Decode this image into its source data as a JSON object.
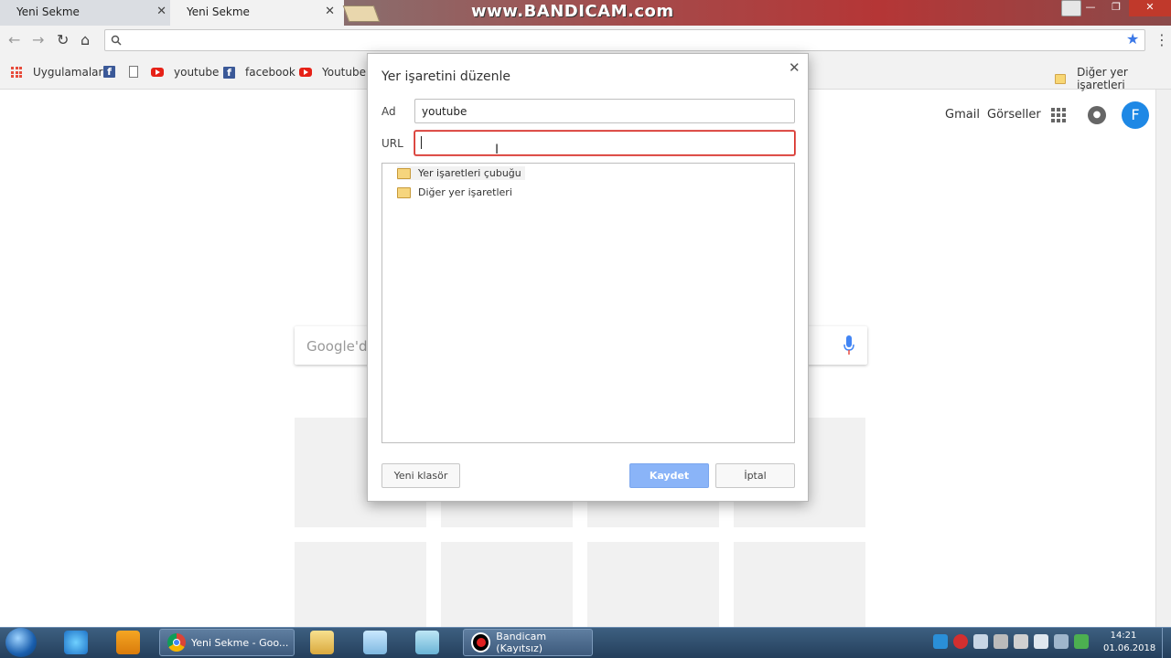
{
  "browser": {
    "tabs": [
      {
        "label": "Yeni Sekme"
      },
      {
        "label": "Yeni Sekme"
      }
    ],
    "watermark": "www.BANDICAM.com"
  },
  "bookmarks": {
    "apps_label": "Uygulamalar",
    "items": [
      "youtube",
      "facebook",
      "Youtube"
    ],
    "other_label": "Diğer yer işaretleri"
  },
  "page": {
    "gmail": "Gmail",
    "images": "Görseller",
    "avatar_letter": "F",
    "search_placeholder": "Google'da"
  },
  "dialog": {
    "title": "Yer işaretini düzenle",
    "name_label": "Ad",
    "name_value": "youtube",
    "url_label": "URL",
    "url_value": "",
    "folders": [
      "Yer işaretleri çubuğu",
      "Diğer yer işaretleri"
    ],
    "new_folder_button": "Yeni klasör",
    "save_button": "Kaydet",
    "cancel_button": "İptal"
  },
  "taskbar": {
    "chrome_task": "Yeni Sekme - Goo...",
    "bandicam_task": "Bandicam (Kayıtsız)",
    "time": "14:21",
    "date": "01.06.2018"
  },
  "colors": {
    "accent": "#3b78e7",
    "primary_button": "#8ab4f8",
    "error_border": "#d93025",
    "avatar": "#1e88e5"
  }
}
